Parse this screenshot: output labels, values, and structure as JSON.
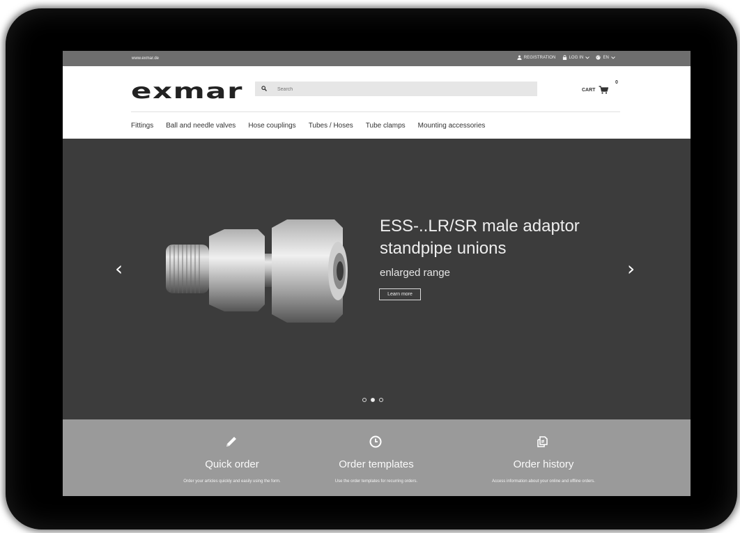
{
  "topbar": {
    "domain": "www.exmar.de",
    "registration": "REGISTRATION",
    "login": "LOG IN",
    "language": "EN"
  },
  "header": {
    "logo": "exmar",
    "search_placeholder": "Search",
    "cart_label": "CART",
    "cart_count": "0"
  },
  "nav": {
    "items": [
      "Fittings",
      "Ball and needle valves",
      "Hose couplings",
      "Tubes / Hoses",
      "Tube clamps",
      "Mounting accessories"
    ]
  },
  "hero": {
    "title_line1": "ESS-..LR/SR male adaptor",
    "title_line2": "standpipe unions",
    "subtitle": "enlarged range",
    "button": "Learn more",
    "prev": "‹",
    "next": "›",
    "active_slide": 2,
    "slide_count": 3
  },
  "features": [
    {
      "icon": "pencil-icon",
      "title": "Quick order",
      "desc": "Order your articles quickly and easily using the form."
    },
    {
      "icon": "clock-icon",
      "title": "Order templates",
      "desc": "Use the order templates for recurring orders."
    },
    {
      "icon": "copy-icon",
      "title": "Order history",
      "desc": "Access information about your online and offline orders."
    }
  ]
}
